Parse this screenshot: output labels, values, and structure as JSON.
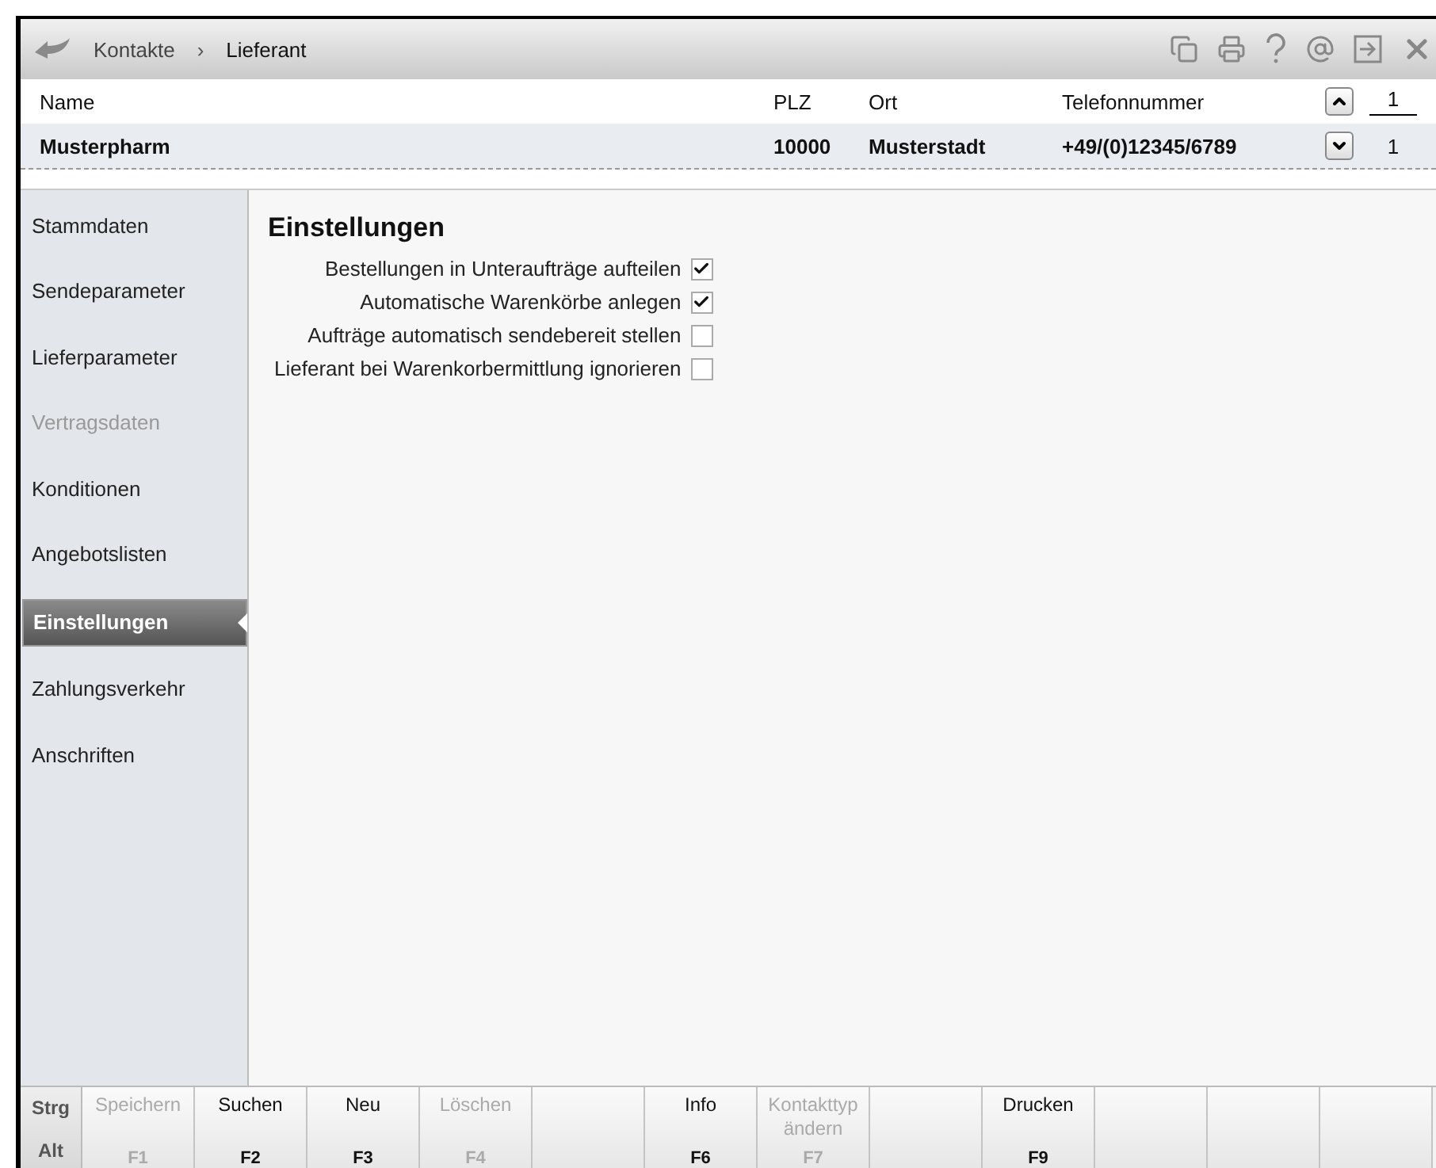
{
  "breadcrumb": {
    "items": [
      {
        "label": "Kontakte",
        "selected": false
      },
      {
        "label": "Lieferant",
        "selected": true
      }
    ],
    "separator": "›"
  },
  "table": {
    "columns": [
      "Name",
      "PLZ",
      "Ort",
      "Telefonnummer"
    ],
    "rows": [
      {
        "cells": [
          "Musterpharm",
          "10000",
          "Musterstadt",
          "+49/(0)12345/6789"
        ]
      }
    ]
  },
  "pager": {
    "current": "1",
    "total": "1"
  },
  "sidebar": {
    "items": [
      {
        "label": "Stammdaten",
        "selected": false,
        "disabled": false
      },
      {
        "label": "Sendeparameter",
        "selected": false,
        "disabled": false
      },
      {
        "label": "Lieferparameter",
        "selected": false,
        "disabled": false
      },
      {
        "label": "Vertragsdaten",
        "selected": false,
        "disabled": true
      },
      {
        "label": "Konditionen",
        "selected": false,
        "disabled": false
      },
      {
        "label": "Angebotslisten",
        "selected": false,
        "disabled": false
      },
      {
        "label": "Einstellungen",
        "selected": true,
        "disabled": false
      },
      {
        "label": "Zahlungsverkehr",
        "selected": false,
        "disabled": false
      },
      {
        "label": "Anschriften",
        "selected": false,
        "disabled": false
      }
    ]
  },
  "content": {
    "title": "Einstellungen",
    "settings": [
      {
        "label": "Bestellungen in Unteraufträge aufteilen",
        "checked": true
      },
      {
        "label": "Automatische Warenkörbe anlegen",
        "checked": true
      },
      {
        "label": "Aufträge automatisch sendebereit stellen",
        "checked": false
      },
      {
        "label": "Lieferant bei Warenkorbermittlung ignorieren",
        "checked": false
      }
    ]
  },
  "function_keys": {
    "modifiers": [
      "Strg",
      "Alt"
    ],
    "buttons": [
      {
        "kind": "key",
        "label": "Speichern",
        "key": "F1",
        "disabled": true
      },
      {
        "kind": "key",
        "label": "Suchen",
        "key": "F2",
        "disabled": false
      },
      {
        "kind": "key",
        "label": "Neu",
        "key": "F3",
        "disabled": false
      },
      {
        "kind": "key",
        "label": "Löschen",
        "key": "F4",
        "disabled": true
      },
      {
        "kind": "blank"
      },
      {
        "kind": "key",
        "label": "Info",
        "key": "F6",
        "disabled": false
      },
      {
        "kind": "key",
        "label": "Kontakttyp ändern",
        "key": "F7",
        "disabled": true
      },
      {
        "kind": "blank"
      },
      {
        "kind": "key",
        "label": "Drucken",
        "key": "F9",
        "disabled": false
      },
      {
        "kind": "blank"
      },
      {
        "kind": "blank"
      },
      {
        "kind": "blank"
      }
    ]
  }
}
